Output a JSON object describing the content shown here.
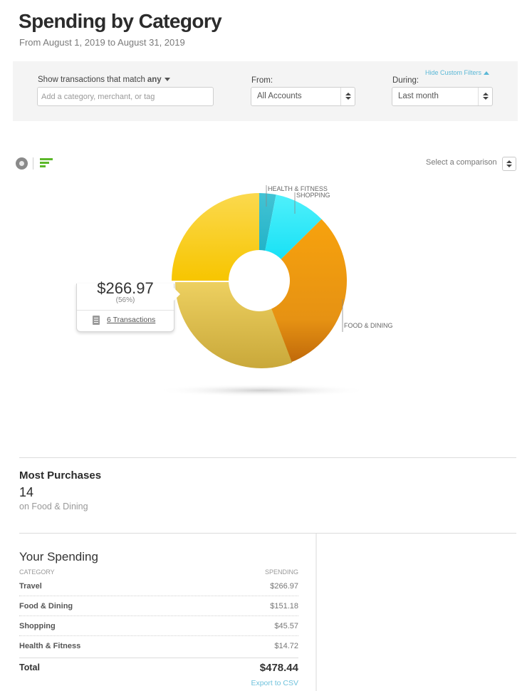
{
  "header": {
    "title": "Spending by Category",
    "subtitle": "From August 1, 2019 to August 31, 2019"
  },
  "filters": {
    "match_label": "Show transactions that match",
    "match_value": "any",
    "search_placeholder": "Add a category, merchant, or tag",
    "search_value": "",
    "from_label": "From:",
    "from_value": "All Accounts",
    "during_label": "During:",
    "during_value": "Last month",
    "hide_filters_label": "Hide Custom Filters"
  },
  "view_toggle": {
    "icons": [
      "donut-chart-icon",
      "bar-list-icon"
    ],
    "active": "donut-chart-icon"
  },
  "comparison": {
    "label": "Select a comparison"
  },
  "tooltip": {
    "amount": "$266.97",
    "percent": "(56%)",
    "transactions_link": "6 Transactions",
    "icon": "document-icon"
  },
  "chart_data": {
    "type": "pie",
    "variant": "donut",
    "title": "",
    "categories": [
      "Travel",
      "Food & Dining",
      "Shopping",
      "Health & Fitness"
    ],
    "values": [
      266.97,
      151.18,
      45.57,
      14.72
    ],
    "labels_shown": [
      "",
      "FOOD & DINING",
      "SHOPPING",
      "HEALTH & FITNESS"
    ],
    "colors": [
      "#f7c400",
      "#f29a0e",
      "#14dcf5",
      "#22b8cf"
    ],
    "selected": "Travel",
    "selected_percent": 56,
    "legend": "none"
  },
  "most_purchases": {
    "title": "Most Purchases",
    "count": "14",
    "subtitle": "on Food & Dining"
  },
  "your_spending": {
    "title": "Your Spending",
    "col_category": "CATEGORY",
    "col_spending": "SPENDING",
    "rows": [
      {
        "category": "Travel",
        "amount": "$266.97"
      },
      {
        "category": "Food & Dining",
        "amount": "$151.18"
      },
      {
        "category": "Shopping",
        "amount": "$45.57"
      },
      {
        "category": "Health & Fitness",
        "amount": "$14.72"
      }
    ],
    "total_label": "Total",
    "total_amount": "$478.44",
    "export_label": "Export to CSV"
  }
}
